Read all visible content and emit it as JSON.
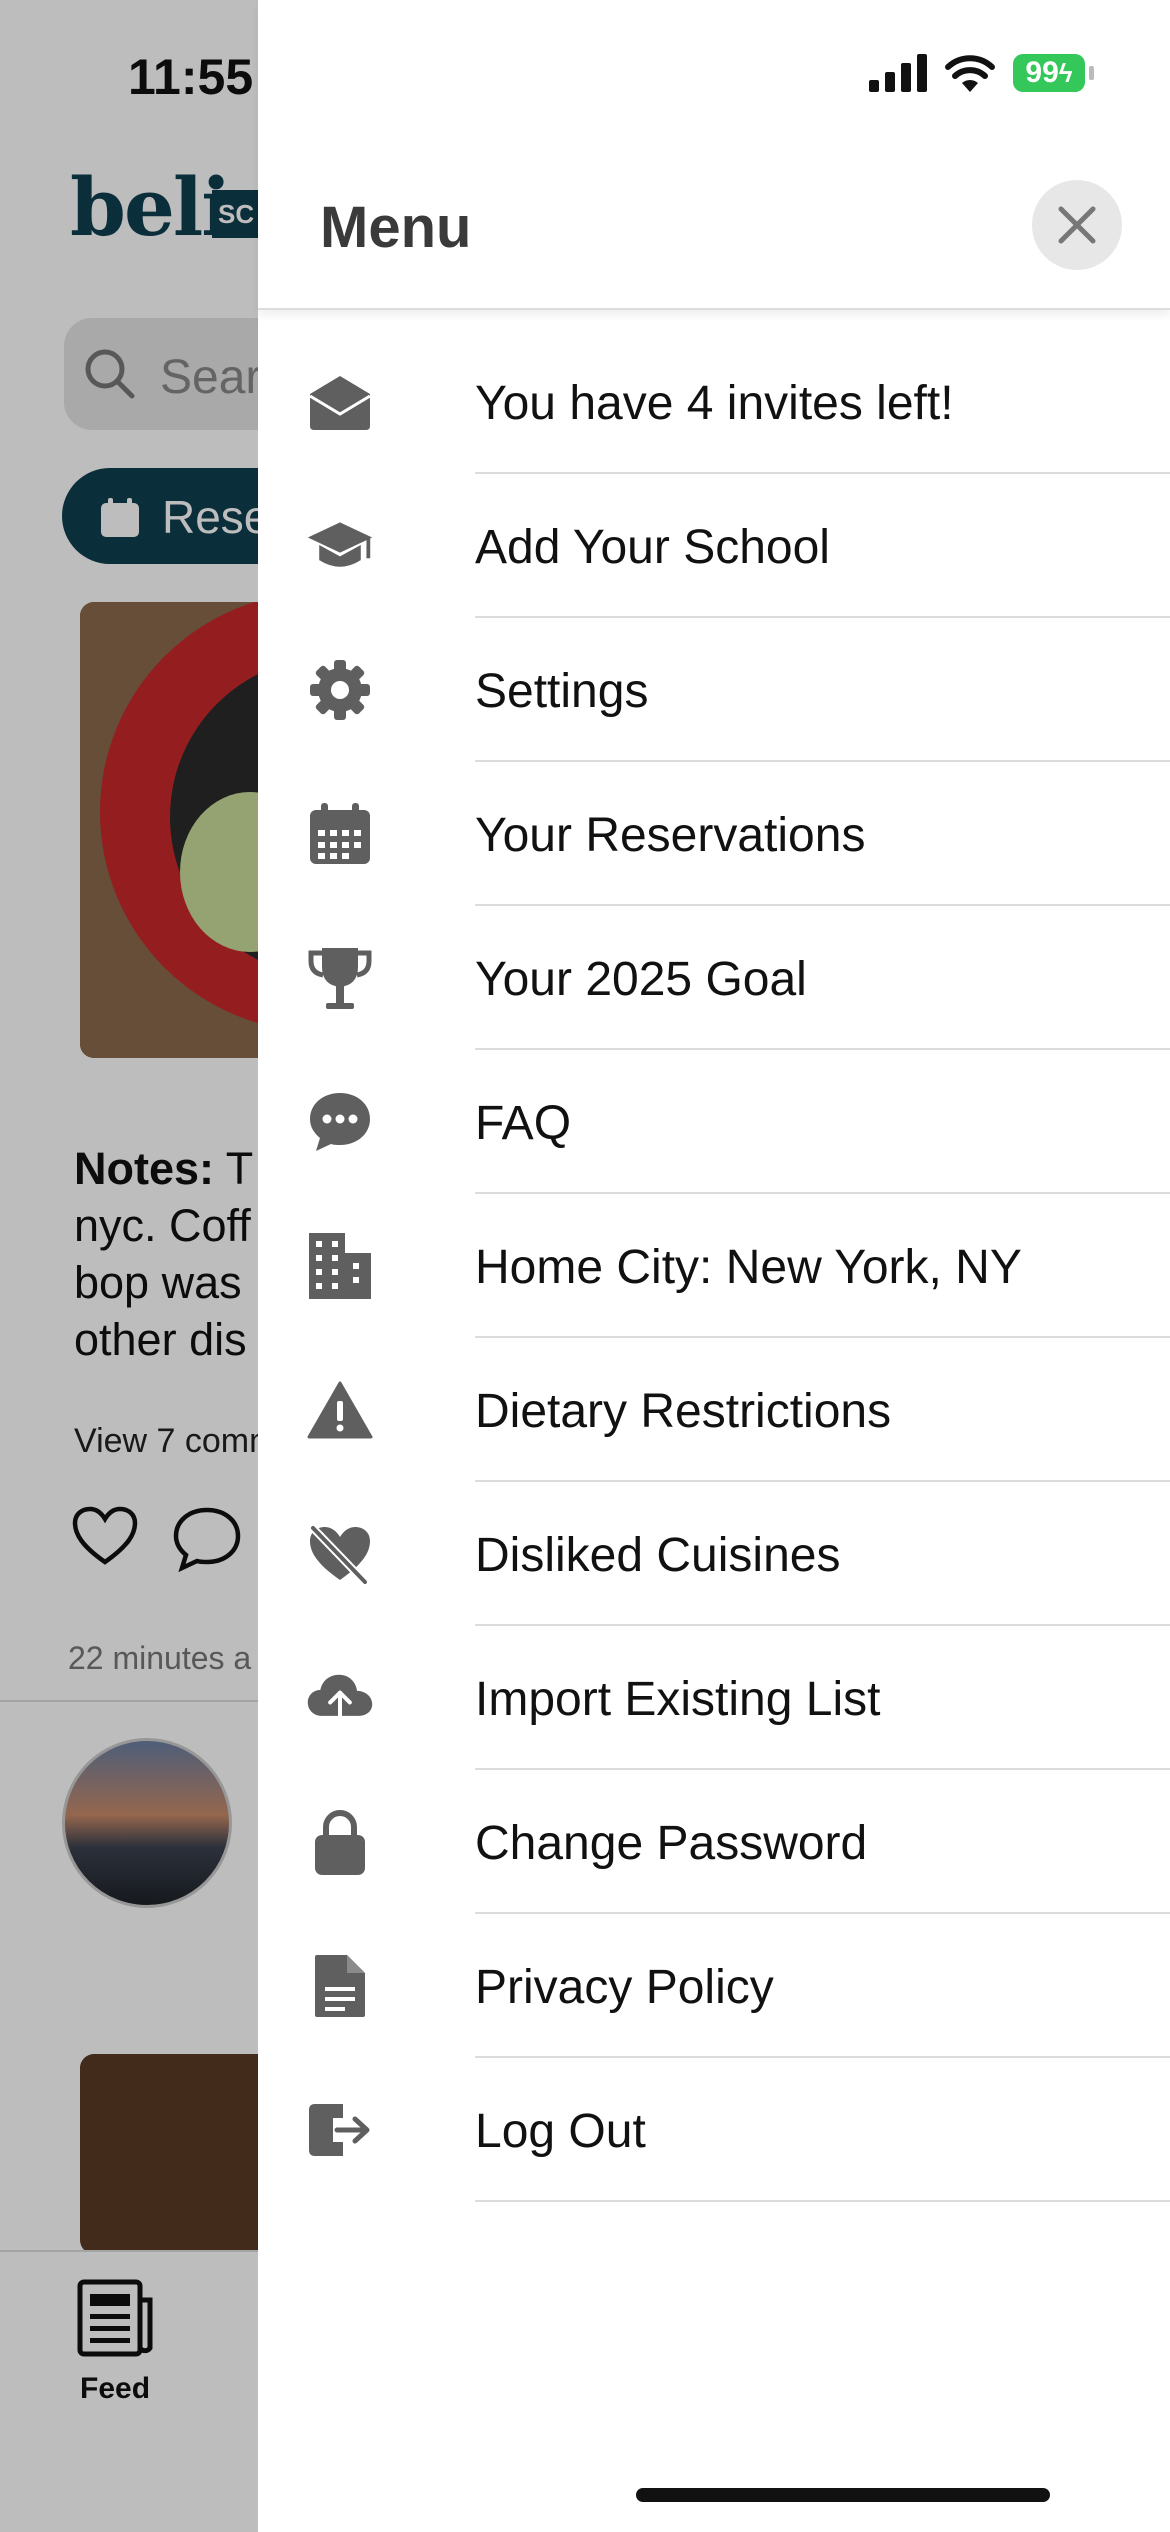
{
  "status_bar": {
    "time": "11:55",
    "battery": "99"
  },
  "background": {
    "logo": "beli",
    "logo_badge": "SC",
    "search_placeholder": "Sear",
    "pill_label": "Rese",
    "notes_label": "Notes:",
    "notes_lines": [
      "T",
      "nyc. Coff",
      "bop was",
      "other dis"
    ],
    "view_comments": "View 7 comm",
    "time_ago": "22 minutes a",
    "tab_feed_label": "Feed"
  },
  "drawer": {
    "title": "Menu",
    "items": [
      {
        "label": "You have 4 invites left!",
        "icon": "envelope-open-icon"
      },
      {
        "label": "Add Your School",
        "icon": "graduation-cap-icon"
      },
      {
        "label": "Settings",
        "icon": "gear-icon"
      },
      {
        "label": "Your Reservations",
        "icon": "calendar-icon"
      },
      {
        "label": "Your 2025 Goal",
        "icon": "trophy-icon"
      },
      {
        "label": "FAQ",
        "icon": "chat-bubble-icon"
      },
      {
        "label": "Home City: New York, NY",
        "icon": "building-icon"
      },
      {
        "label": "Dietary Restrictions",
        "icon": "warning-icon"
      },
      {
        "label": "Disliked Cuisines",
        "icon": "heart-slash-icon"
      },
      {
        "label": "Import Existing List",
        "icon": "cloud-upload-icon"
      },
      {
        "label": "Change Password",
        "icon": "lock-icon"
      },
      {
        "label": "Privacy Policy",
        "icon": "document-icon"
      },
      {
        "label": "Log Out",
        "icon": "logout-icon"
      }
    ]
  },
  "colors": {
    "brand": "#0e3e4f",
    "icon_gray": "#5f5f5f",
    "battery_green": "#34c759"
  }
}
